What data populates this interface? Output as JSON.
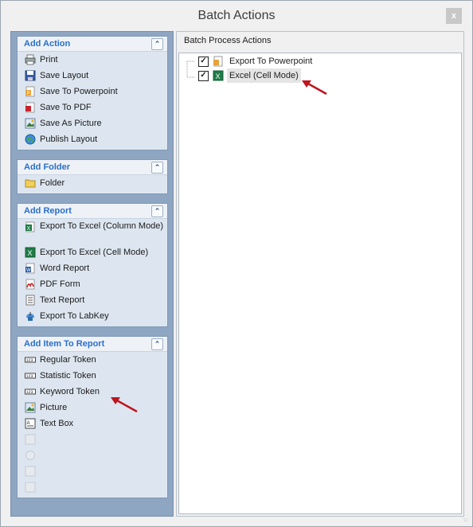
{
  "window": {
    "title": "Batch Actions",
    "close_label": "x"
  },
  "left": {
    "groups": [
      {
        "title": "Add Action",
        "collapse_glyph": "»",
        "items": [
          {
            "label": "Print",
            "icon": "printer-icon"
          },
          {
            "label": "Save Layout",
            "icon": "floppy-disk-icon"
          },
          {
            "label": "Save To Powerpoint",
            "icon": "powerpoint-icon"
          },
          {
            "label": "Save To PDF",
            "icon": "pdf-icon"
          },
          {
            "label": "Save As Picture",
            "icon": "picture-icon"
          },
          {
            "label": "Publish Layout",
            "icon": "globe-icon"
          }
        ]
      },
      {
        "title": "Add Folder",
        "collapse_glyph": "»",
        "items": [
          {
            "label": "Folder",
            "icon": "folder-icon"
          }
        ]
      },
      {
        "title": "Add Report",
        "collapse_glyph": "»",
        "items": [
          {
            "label": "Export To Excel (Column Mode)",
            "icon": "excel-icon"
          },
          {
            "label": "Export To Excel (Cell Mode)",
            "icon": "excel-icon"
          },
          {
            "label": "Word Report",
            "icon": "word-icon"
          },
          {
            "label": "PDF Form",
            "icon": "pdf-form-icon"
          },
          {
            "label": "Text Report",
            "icon": "text-report-icon"
          },
          {
            "label": "Export To LabKey",
            "icon": "labkey-icon"
          }
        ]
      },
      {
        "title": "Add Item To Report",
        "collapse_glyph": "»",
        "items": [
          {
            "label": "Regular Token",
            "icon": "token-icon"
          },
          {
            "label": "Statistic Token",
            "icon": "token-icon"
          },
          {
            "label": "Keyword Token",
            "icon": "token-icon"
          },
          {
            "label": "Picture",
            "icon": "picture-icon"
          },
          {
            "label": "Text Box",
            "icon": "text-box-icon"
          }
        ],
        "disabled_items": [
          {
            "icon": "disabled-item-icon"
          },
          {
            "icon": "disabled-item-icon"
          },
          {
            "icon": "disabled-item-icon"
          },
          {
            "icon": "disabled-item-icon"
          }
        ]
      }
    ]
  },
  "right": {
    "header": "Batch Process Actions",
    "tree": [
      {
        "label": "Export To Powerpoint",
        "checked": true,
        "icon": "powerpoint-icon"
      },
      {
        "label": "Excel (Cell Mode)",
        "checked": true,
        "icon": "excel-icon"
      }
    ]
  },
  "colors": {
    "panel_bg": "#8fa6c2",
    "group_header_text": "#2a6fc9",
    "arrow": "#c0141e"
  }
}
